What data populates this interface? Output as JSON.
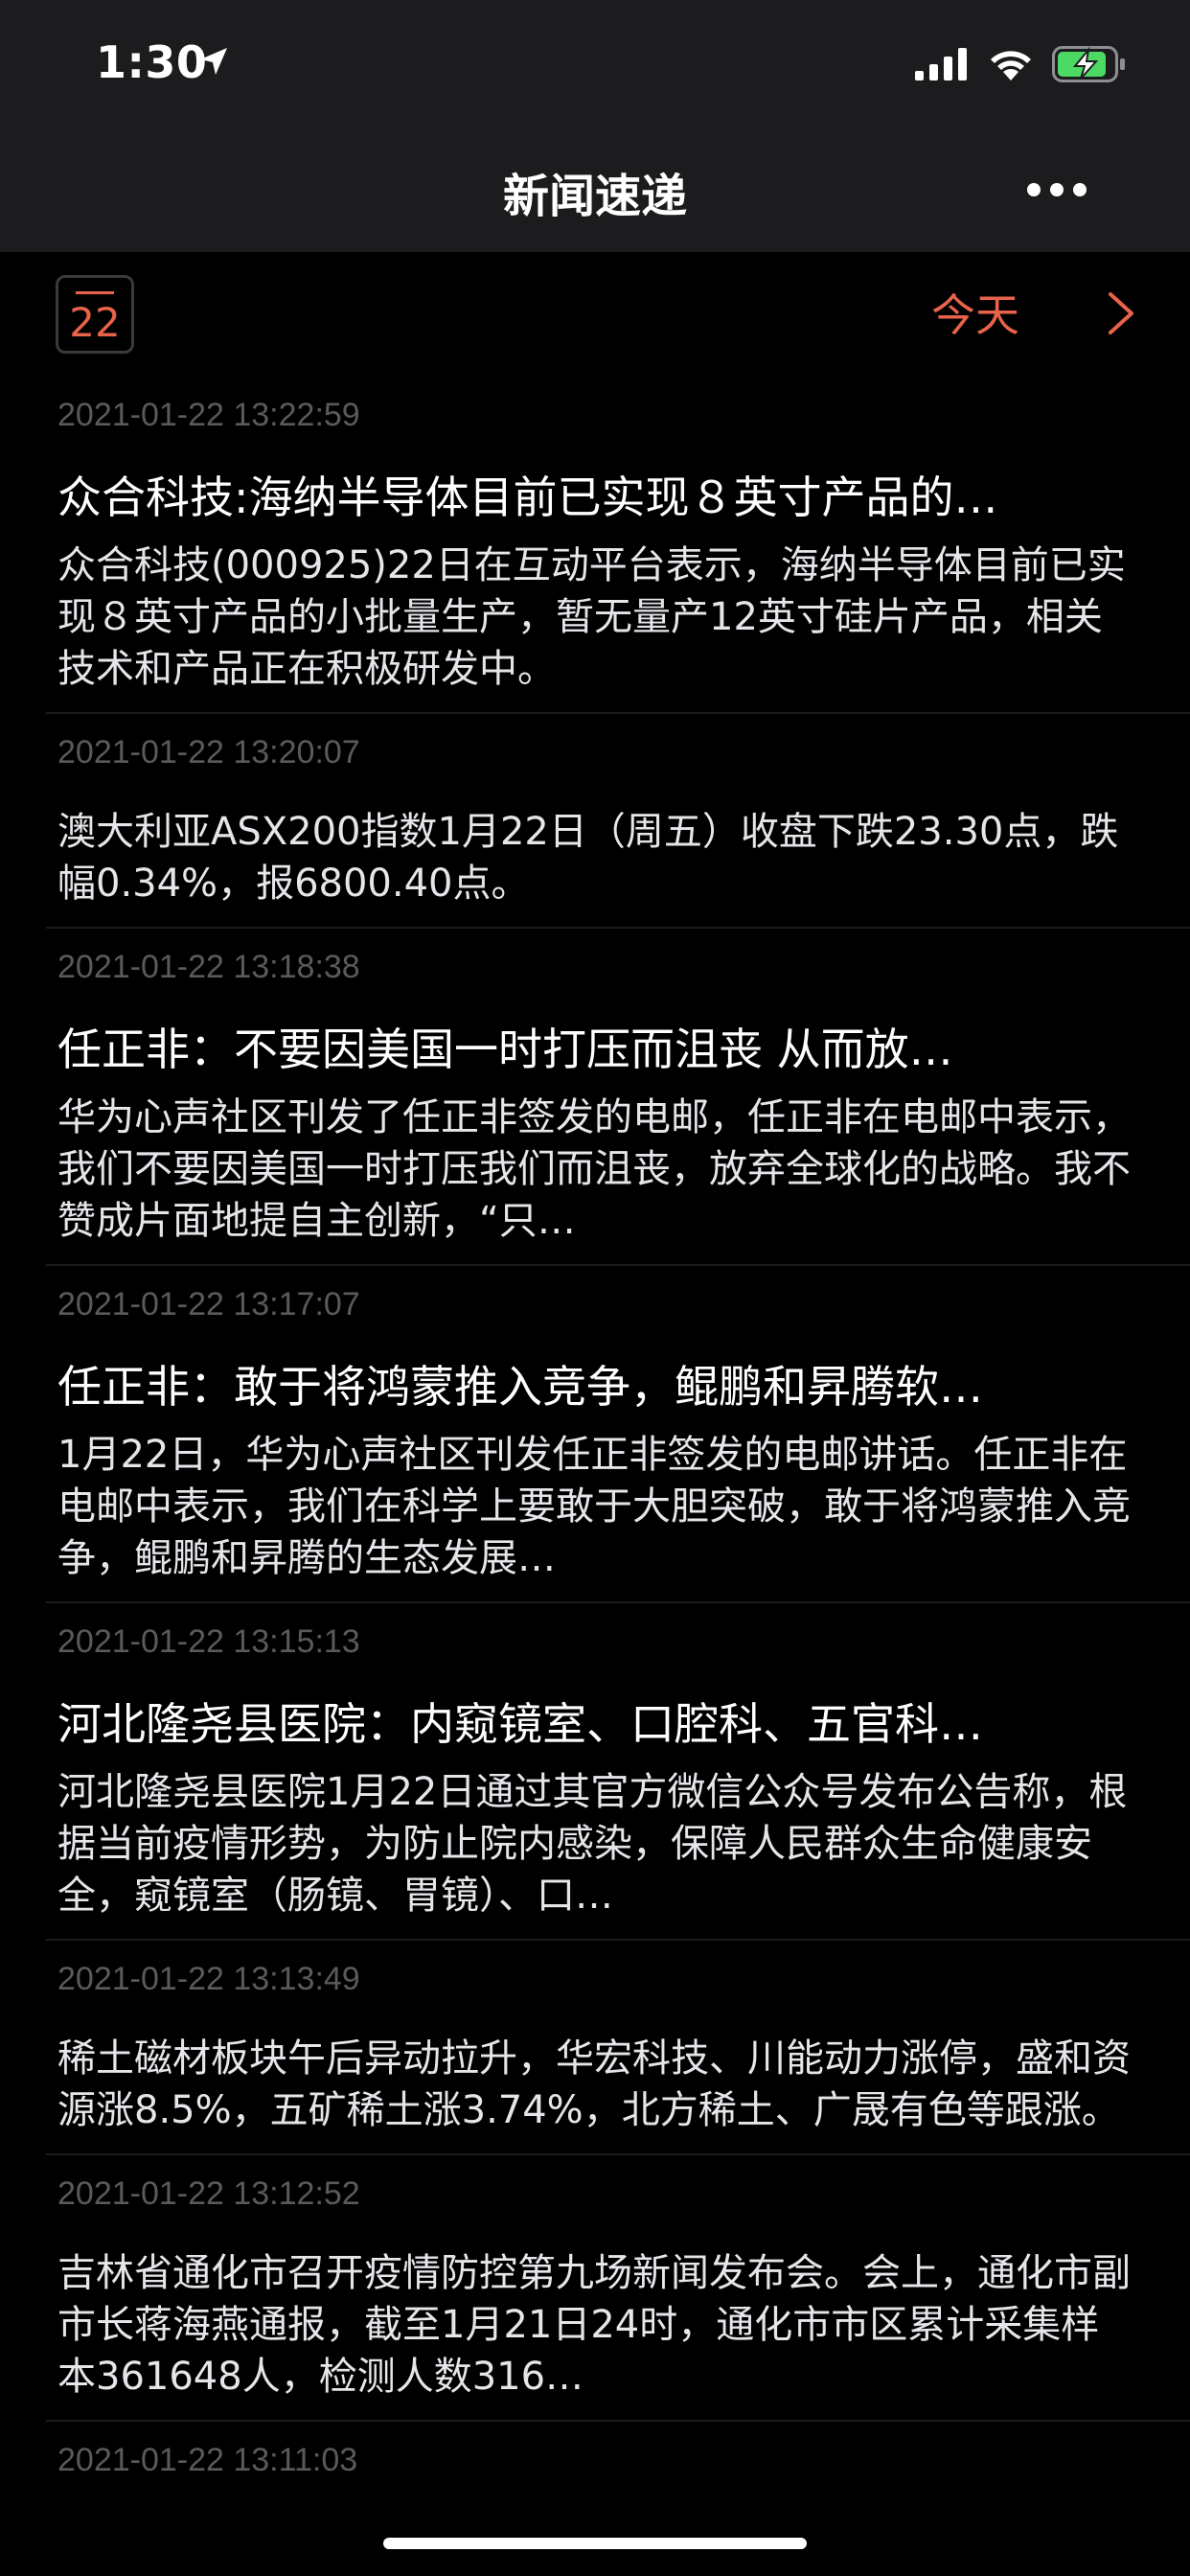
{
  "status_bar": {
    "time": "1:30"
  },
  "nav": {
    "title": "新闻速递"
  },
  "date_bar": {
    "day": "22",
    "today_label": "今天"
  },
  "news": [
    {
      "time": "2021-01-22 13:22:59",
      "title": "众合科技:海纳半导体目前已实现８英寸产品的…",
      "body": "众合科技(000925)22日在互动平台表示，海纳半导体目前已实现８英寸产品的小批量生产，暂无量产12英寸硅片产品，相关技术和产品正在积极研发中。"
    },
    {
      "time": "2021-01-22 13:20:07",
      "title": "",
      "body": "澳大利亚ASX200指数1月22日（周五）收盘下跌23.30点，跌幅0.34%，报6800.40点。"
    },
    {
      "time": "2021-01-22 13:18:38",
      "title": "任正非：不要因美国一时打压而沮丧 从而放…",
      "body": "华为心声社区刊发了任正非签发的电邮，任正非在电邮中表示，我们不要因美国一时打压我们而沮丧，放弃全球化的战略。我不赞成片面地提自主创新，“只…"
    },
    {
      "time": "2021-01-22 13:17:07",
      "title": "任正非：敢于将鸿蒙推入竞争，鲲鹏和昇腾软…",
      "body": "1月22日，华为心声社区刊发任正非签发的电邮讲话。任正非在电邮中表示，我们在科学上要敢于大胆突破，敢于将鸿蒙推入竞争，鲲鹏和昇腾的生态发展…"
    },
    {
      "time": "2021-01-22 13:15:13",
      "title": "河北隆尧县医院：内窥镜室、口腔科、五官科…",
      "body": "河北隆尧县医院1月22日通过其官方微信公众号发布公告称，根据当前疫情形势，为防止院内感染，保障人民群众生命健康安全，窥镜室（肠镜、胃镜）、口…"
    },
    {
      "time": "2021-01-22 13:13:49",
      "title": "",
      "body": "稀土磁材板块午后异动拉升，华宏科技、川能动力涨停，盛和资源涨8.5%，五矿稀土涨3.74%，北方稀土、广晟有色等跟涨。"
    },
    {
      "time": "2021-01-22 13:12:52",
      "title": "",
      "body": "吉林省通化市召开疫情防控第九场新闻发布会。会上，通化市副市长蒋海燕通报，截至1月21日24时，通化市市区累计采集样本361648人，检测人数316…"
    },
    {
      "time": "2021-01-22 13:11:03",
      "title": "",
      "body": ""
    }
  ]
}
